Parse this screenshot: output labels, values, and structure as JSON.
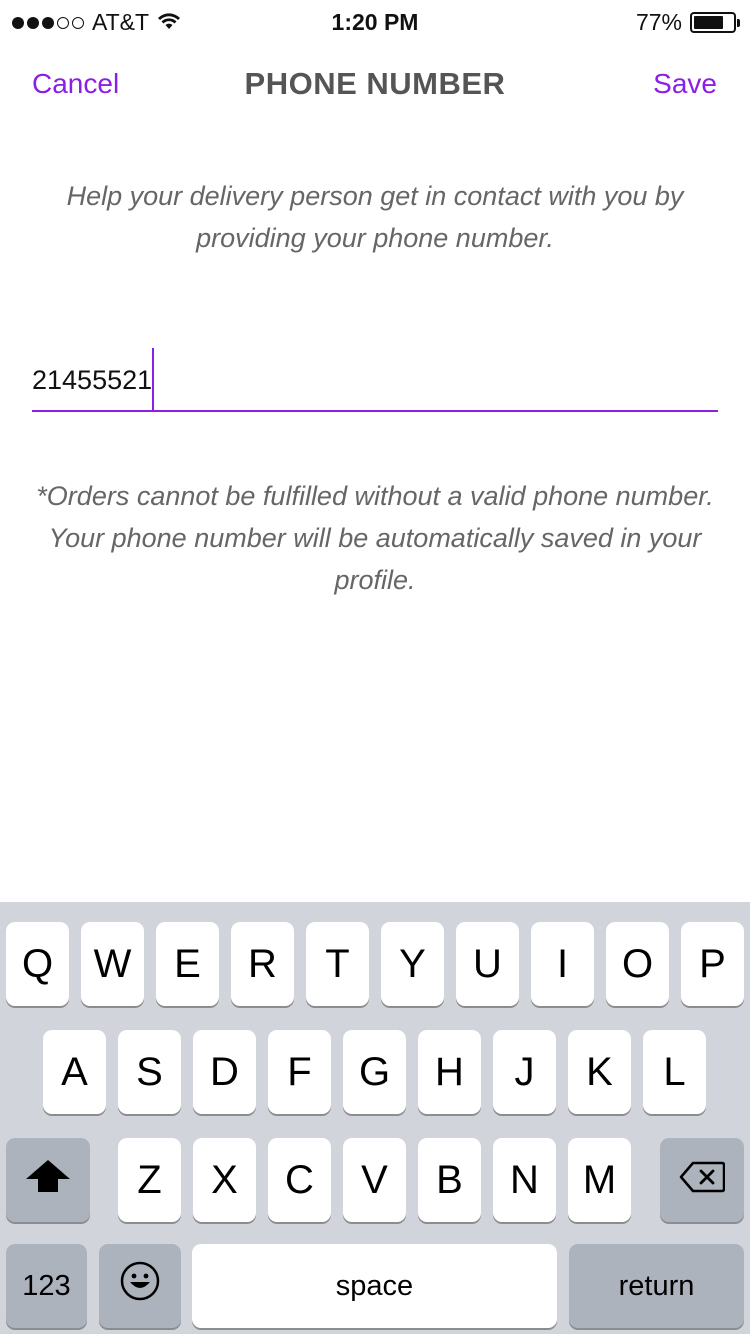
{
  "status_bar": {
    "carrier": "AT&T",
    "time": "1:20 PM",
    "battery_percent": "77%",
    "battery_level": 0.77,
    "signal_bars": 3,
    "signal_total": 5
  },
  "nav": {
    "cancel_label": "Cancel",
    "title": "PHONE NUMBER",
    "save_label": "Save"
  },
  "helper_text": "Help your delivery person get in contact with you by providing your phone number.",
  "phone_input": {
    "value": "21455521"
  },
  "note_text": "*Orders cannot be fulfilled without a valid phone number. Your phone number will be automatically saved in your profile.",
  "keyboard": {
    "row1": [
      "Q",
      "W",
      "E",
      "R",
      "T",
      "Y",
      "U",
      "I",
      "O",
      "P"
    ],
    "row2": [
      "A",
      "S",
      "D",
      "F",
      "G",
      "H",
      "J",
      "K",
      "L"
    ],
    "row3": [
      "Z",
      "X",
      "C",
      "V",
      "B",
      "N",
      "M"
    ],
    "numbers_label": "123",
    "space_label": "space",
    "return_label": "return"
  },
  "colors": {
    "accent": "#8a1fe6",
    "keyboard_bg": "#d1d4da",
    "dark_key": "#acb3bd"
  }
}
